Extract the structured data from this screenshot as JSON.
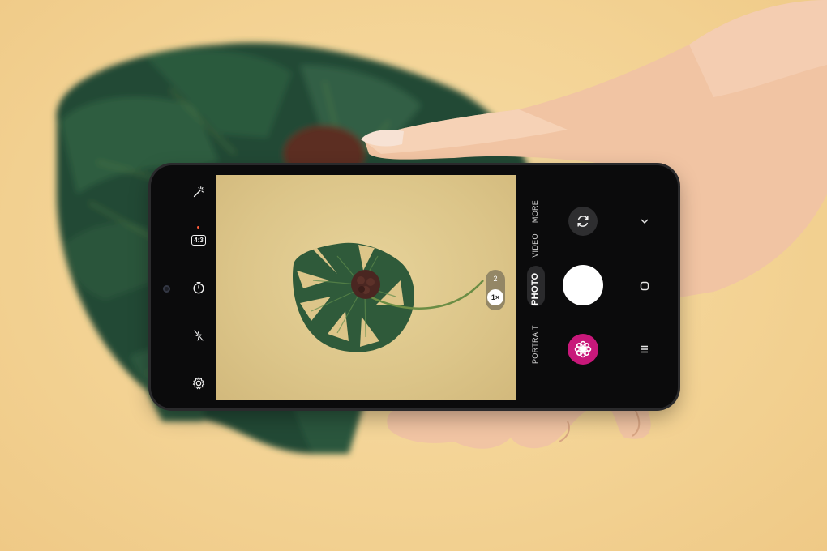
{
  "camera": {
    "left_toolbar": [
      {
        "icon": "magic-wand-icon"
      },
      {
        "icon": "aspect-ratio-icon",
        "label": "4:3"
      },
      {
        "icon": "timer-icon"
      },
      {
        "icon": "flash-off-icon"
      },
      {
        "icon": "settings-icon"
      }
    ],
    "zoom": {
      "options": [
        "2",
        "1×"
      ],
      "selected": "1×"
    },
    "modes": {
      "more": "MORE",
      "video": "VIDEO",
      "photo": "PHOTO",
      "portrait": "PORTRAIT"
    },
    "selected_mode": "PHOTO",
    "colors": {
      "gallery": "#c8187a",
      "shutter": "#ffffff",
      "flash_indicator": "#ff5b3a"
    },
    "right_controls": {
      "switch_icon": "camera-switch-icon",
      "gallery_icon": "flower-icon",
      "nav_icons": [
        "chevron-down-icon",
        "home-icon",
        "menu-icon"
      ]
    }
  }
}
